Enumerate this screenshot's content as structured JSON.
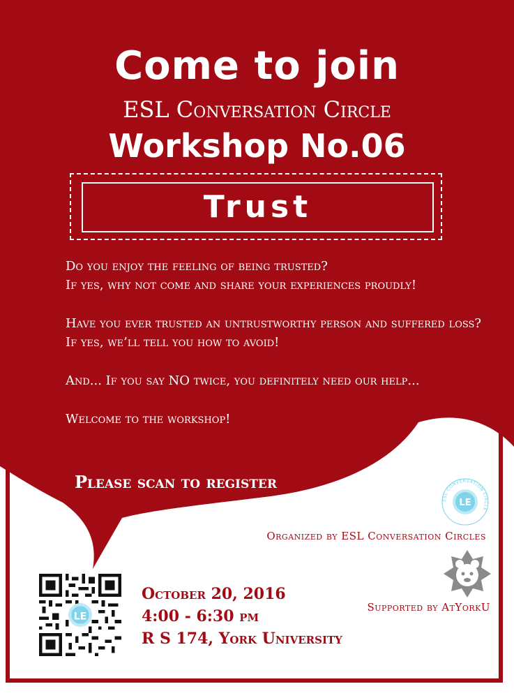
{
  "poster": {
    "title_line1": "Come to join",
    "title_line2": "ESL Conversation Circle",
    "title_line3": "Workshop No.06",
    "topic": "Trust"
  },
  "body": {
    "line1": "Do you enjoy the feeling of being trusted?",
    "line2": "If yes, why not come and share your experiences proudly!",
    "line3": "Have you ever trusted an untrustworthy person and suffered loss?",
    "line4": "If yes, we’ll tell you how to avoid!",
    "line5": "And... If you say NO twice, you definitely need our help...",
    "line6": "Welcome to the workshop!"
  },
  "register": {
    "label": "Please scan to register"
  },
  "credits": {
    "organized": "Organized by ESL Conversation Circles",
    "supported": "Supported by AtYorkU"
  },
  "event": {
    "date": "October 20, 2016",
    "time": "4:00 - 6:30 pm",
    "location": "R S 174, York University"
  },
  "logos": {
    "esl_ring_text": "ESL CONVERSATION CIRCLE",
    "esl_monogram": "LE"
  },
  "colors": {
    "brand_red": "#a30b14",
    "background": "#ffffff",
    "esl_logo_blue": "#7fd3ea",
    "york_logo_gray": "#8a8a8a"
  }
}
